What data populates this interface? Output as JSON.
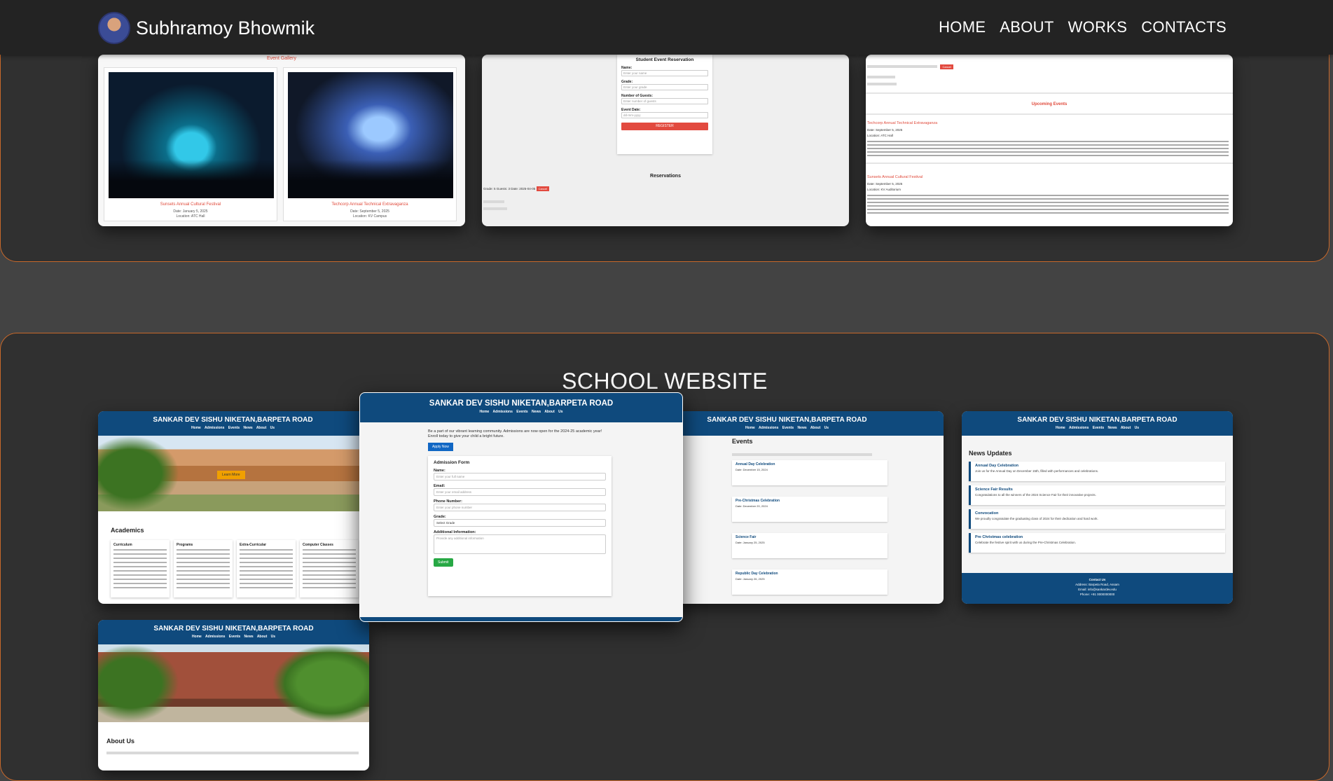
{
  "brand": {
    "name": "Subhramoy Bhowmik"
  },
  "nav": {
    "items": [
      "HOME",
      "ABOUT",
      "WORKS",
      "CONTACTS"
    ]
  },
  "colors": {
    "accent": "#c8682a",
    "school_blue": "#0f4a7d",
    "event_red": "#e04a3b"
  },
  "event_section": {
    "gallery": {
      "heading": "Event Gallery",
      "cards": [
        {
          "title": "Sunsets Annual Cultural Festival",
          "date": "Date: January 5, 2025",
          "location": "Location: ATC Hall"
        },
        {
          "title": "Techcorp Annual Technical Extravaganza",
          "date": "Date: September 5, 2025",
          "location": "Location: KV Campus"
        }
      ]
    },
    "reservation": {
      "form_title": "Student Event Reservation",
      "name_label": "Name:",
      "name_placeholder": "Enter your name",
      "grade_label": "Grade:",
      "grade_placeholder": "Enter your grade",
      "guests_label": "Number of Guests:",
      "guests_placeholder": "Enter number of guests",
      "date_label": "Event Date:",
      "date_value": "dd-mm-yyyy",
      "register": "REGISTER",
      "reservations_title": "Reservations",
      "row": "Grade: 5  Guests: 3  Date: 2025-04-05",
      "cancel": "Cancel"
    },
    "upcoming": {
      "title": "Upcoming Events",
      "event1": "Techcorp Annual Technical Extravaganza",
      "event1_date": "Date: September 5, 2025",
      "event1_loc": "Location: ATC Hall",
      "event2": "Sunsets Annual Cultural Festival",
      "event2_date": "Date: September 5, 2025",
      "event2_loc": "Location: KV Auditorium"
    }
  },
  "school_section": {
    "title": "SCHOOL WEBSITE",
    "site_title": "SANKAR DEV SISHU NIKETAN,BARPETA ROAD",
    "site_nav": "Home Admissions Events News About Us",
    "home": {
      "learn_more": "Learn More",
      "academics": "Academics",
      "cards": [
        "Curriculum",
        "Programs",
        "Extra-Curricular",
        "Computer Classes"
      ]
    },
    "admission": {
      "intro": "Be a part of our vibrant learning community. Admissions are now open for the 2024-25 academic year! Enroll today to give your child a bright future.",
      "apply": "Apply Now",
      "form_title": "Admission Form",
      "name_label": "Name:",
      "name_placeholder": "Enter your full name",
      "email_label": "Email:",
      "email_placeholder": "Enter your email address",
      "phone_label": "Phone Number:",
      "phone_placeholder": "Enter your phone number",
      "grade_label": "Grade:",
      "grade_value": "Select Grade",
      "info_label": "Additional Information:",
      "info_placeholder": "Provide any additional information",
      "submit": "Submit"
    },
    "events": {
      "title": "Events",
      "items": [
        {
          "name": "Annual Day Celebration",
          "date": "Date: December 15, 2024"
        },
        {
          "name": "Pre-Christmas Celebration",
          "date": "Date: December 20, 2024"
        },
        {
          "name": "Science Fair",
          "date": "Date: January 25, 2025"
        },
        {
          "name": "Republic Day Celebration",
          "date": "Date: January 26, 2025"
        }
      ]
    },
    "news": {
      "title": "News Updates",
      "items": [
        {
          "name": "Annual Day Celebration",
          "desc": "Join us for the Annual Day on December 15th, filled with performances and celebrations."
        },
        {
          "name": "Science Fair Results",
          "desc": "Congratulations to all the winners of the 2024 Science Fair for their innovative projects."
        },
        {
          "name": "Convocation",
          "desc": "We proudly congratulate the graduating class of 2024 for their dedication and hard work."
        },
        {
          "name": "Pre Christmas celebration",
          "desc": "Celebrate the festive spirit with us during the Pre-Christmas Celebration."
        }
      ],
      "footer_title": "Contact Us",
      "footer_lines": [
        "Address: Barpeta Road, Assam",
        "Email: info@sankardev.edu",
        "Phone: +91 0000000000"
      ]
    },
    "about": {
      "title": "About Us"
    }
  }
}
